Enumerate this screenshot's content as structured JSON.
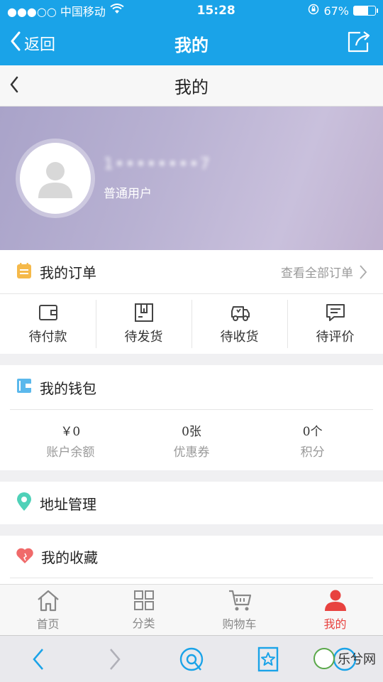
{
  "status": {
    "carrier": "●●●○○ 中国移动",
    "time": "15:28",
    "battery": "67%",
    "battery_level": 0.67
  },
  "navbar": {
    "back_label": "返回",
    "title": "我的"
  },
  "page_header": {
    "title": "我的"
  },
  "profile": {
    "user_name": "1••••••••7",
    "user_level": "普通用户"
  },
  "orders": {
    "title": "我的订单",
    "view_all": "查看全部订单",
    "items": [
      {
        "label": "待付款",
        "icon": "wallet-icon"
      },
      {
        "label": "待发货",
        "icon": "package-icon"
      },
      {
        "label": "待收货",
        "icon": "truck-icon"
      },
      {
        "label": "待评价",
        "icon": "comment-icon"
      }
    ]
  },
  "wallet": {
    "title": "我的钱包",
    "items": [
      {
        "value": "￥0",
        "label": "账户余额"
      },
      {
        "value": "0张",
        "label": "优惠券"
      },
      {
        "value": "0个",
        "label": "积分"
      }
    ]
  },
  "address": {
    "title": "地址管理"
  },
  "favorites": {
    "title": "我的收藏"
  },
  "tabbar": {
    "items": [
      {
        "label": "首页",
        "icon": "home-icon"
      },
      {
        "label": "分类",
        "icon": "grid-icon"
      },
      {
        "label": "购物车",
        "icon": "cart-icon"
      },
      {
        "label": "我的",
        "icon": "user-icon"
      }
    ]
  },
  "watermark": {
    "text": "乐兮网"
  },
  "colors": {
    "brand_blue": "#1aa3e8",
    "active_red": "#e8423f",
    "order_icon": "#f5b94a",
    "wallet_icon": "#5bb8ec",
    "address_icon": "#4fd1b8",
    "favorite_icon": "#f06a6a"
  }
}
